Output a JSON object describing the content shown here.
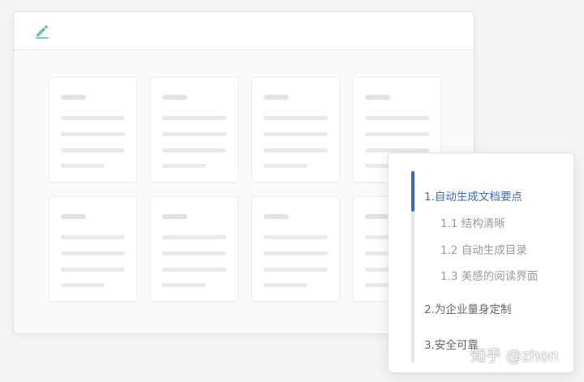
{
  "app": {
    "icon": "pencil-icon",
    "accent_color": "#5cc4a7"
  },
  "toc": {
    "accent_color": "#3c6bb5",
    "items": [
      {
        "label": "1.自动生成文档要点",
        "level": 1,
        "active": true
      },
      {
        "label": "1.1 结构清晰",
        "level": 2,
        "active": false
      },
      {
        "label": "1.2 自动生成目录",
        "level": 2,
        "active": false
      },
      {
        "label": "1.3 美感的阅读界面",
        "level": 2,
        "active": false
      },
      {
        "label": "2.为企业量身定制",
        "level": 1,
        "active": false
      },
      {
        "label": "3.安全可靠",
        "level": 1,
        "active": false
      }
    ]
  },
  "watermark": "知乎 @zhon"
}
